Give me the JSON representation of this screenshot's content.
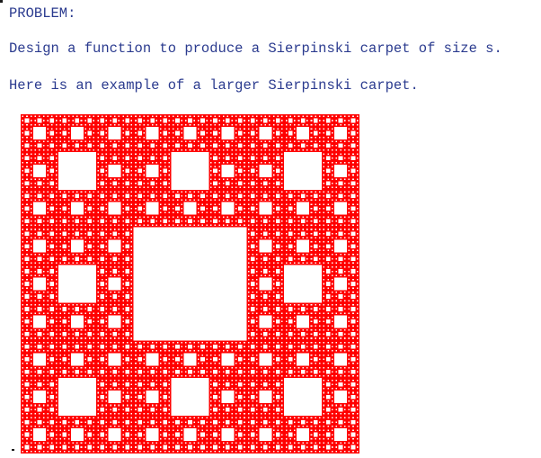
{
  "content": {
    "heading": "PROBLEM:",
    "lines": [
      "Design a function to produce a Sierpinski carpet of size s.",
      "Here is an example of a larger Sierpinski carpet."
    ]
  },
  "carpet": {
    "fill_color": "#ff0000",
    "hole_color": "#ffffff",
    "recursion_levels": 5
  },
  "colors": {
    "text": "#2b3b8f",
    "background": "#ffffff"
  }
}
